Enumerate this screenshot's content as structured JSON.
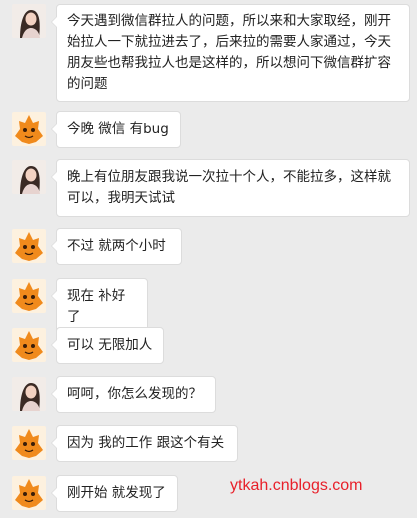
{
  "messages": [
    {
      "sender": "woman",
      "text": "今天遇到微信群拉人的问题，所以来和大家取经，刚开始拉人一下就拉进去了，后来拉的需要人家通过，今天朋友些也帮我拉人也是这样的，所以想问下微信群扩容的问题"
    },
    {
      "sender": "mascot",
      "text": "今晚 微信 有bug"
    },
    {
      "sender": "woman",
      "text": "晚上有位朋友跟我说一次拉十个人，不能拉多，这样就可以，我明天试试"
    },
    {
      "sender": "mascot",
      "text": "不过 就两个小时"
    },
    {
      "sender": "mascot",
      "text": "现在 补好了"
    },
    {
      "sender": "mascot",
      "text": "可以 无限加人"
    },
    {
      "sender": "woman",
      "text": "呵呵，你怎么发现的？"
    },
    {
      "sender": "mascot",
      "text": "因为 我的工作 跟这个有关"
    },
    {
      "sender": "mascot",
      "text": "刚开始 就发现了"
    }
  ],
  "watermark": "ytkah.cnblogs.com",
  "colors": {
    "background": "#ebebeb",
    "bubble": "#ffffff",
    "watermark": "#e8202a",
    "mascot": "#f08a1c"
  }
}
